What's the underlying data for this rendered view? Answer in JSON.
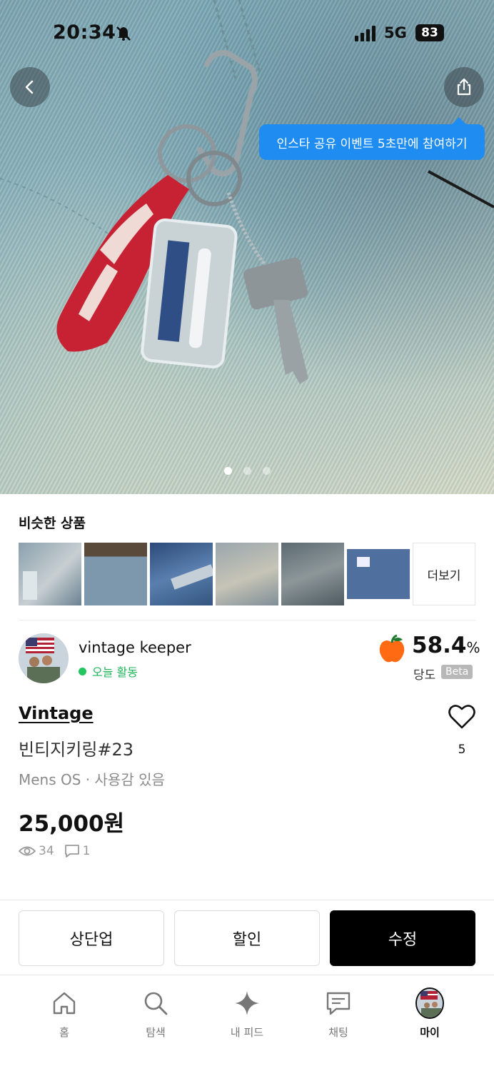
{
  "status_bar": {
    "time": "20:34",
    "network": "5G",
    "battery": "83"
  },
  "hero": {
    "share_tooltip": "인스타 공유 이벤트 5초만에 참여하기",
    "page_count": 3,
    "active_page": 1
  },
  "similar": {
    "title": "비슷한 상품",
    "more_label": "더보기"
  },
  "seller": {
    "name": "vintage keeper",
    "activity": "오늘 활동",
    "temperature": "58.4",
    "temperature_unit": "%",
    "temperature_label": "당도",
    "beta": "Beta"
  },
  "product": {
    "brand": "Vintage",
    "title": "빈티지키링#23",
    "meta": "Mens OS · 사용감 있음",
    "price": "25,000원",
    "views": "34",
    "chats": "1",
    "likes": "5"
  },
  "actions": {
    "bump": "상단업",
    "discount": "할인",
    "edit": "수정"
  },
  "nav": {
    "home": "홈",
    "search": "탐색",
    "feed": "내 피드",
    "chat": "채팅",
    "my": "마이"
  },
  "colors": {
    "accent_blue": "#1e8cf0",
    "active_green": "#22c55e",
    "primary_black": "#000000"
  }
}
